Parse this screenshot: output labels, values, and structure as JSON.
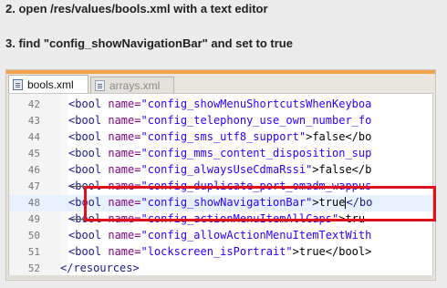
{
  "steps": {
    "step2": "2. open /res/values/bools.xml with a text editor",
    "step3": "3. find \"config_showNavigationBar\" and set to true"
  },
  "tabs": [
    {
      "label": "bools.xml",
      "active": true
    },
    {
      "label": "arrays.xml",
      "active": false
    }
  ],
  "lines": [
    {
      "n": "42",
      "tag": "<bool ",
      "attr": "name=",
      "value": "\"config_showMenuShortcutsWhenKeyboa",
      "rest": ""
    },
    {
      "n": "43",
      "tag": "<bool ",
      "attr": "name=",
      "value": "\"config_telephony_use_own_number_fo",
      "rest": ""
    },
    {
      "n": "44",
      "tag": "<bool ",
      "attr": "name=",
      "value": "\"config_sms_utf8_support\"",
      "rest": ">false</bo"
    },
    {
      "n": "45",
      "tag": "<bool ",
      "attr": "name=",
      "value": "\"config_mms_content_disposition_sup",
      "rest": ""
    },
    {
      "n": "46",
      "tag": "<bool ",
      "attr": "name=",
      "value": "\"config_alwaysUseCdmaRssi\"",
      "rest": ">false</b"
    },
    {
      "n": "47",
      "tag": "<bool ",
      "attr": "name=",
      "value": "\"config_duplicate_port_omadm_wappus",
      "rest": ""
    },
    {
      "n": "48",
      "tag": "<bool ",
      "attr": "name=",
      "value": "\"config_showNavigationBar\"",
      "rest": ">true",
      "rest2": "</bo"
    },
    {
      "n": "49",
      "tag": "<bool ",
      "attr": "name=",
      "value": "\"config_actionMenuItemAllCaps\"",
      "rest": ">tru"
    },
    {
      "n": "50",
      "tag": "<bool ",
      "attr": "name=",
      "value": "\"config_allowActionMenuItemTextWith",
      "rest": ""
    },
    {
      "n": "51",
      "tag": "<bool ",
      "attr": "name=",
      "value": "\"lockscreen_isPortrait\"",
      "rest": ">true</bool>"
    },
    {
      "n": "52",
      "tag": "</resources>",
      "attr": "",
      "value": "",
      "rest": ""
    }
  ],
  "colors": {
    "highlight": "#e0111b",
    "accent_strip": "#f2a24a"
  }
}
